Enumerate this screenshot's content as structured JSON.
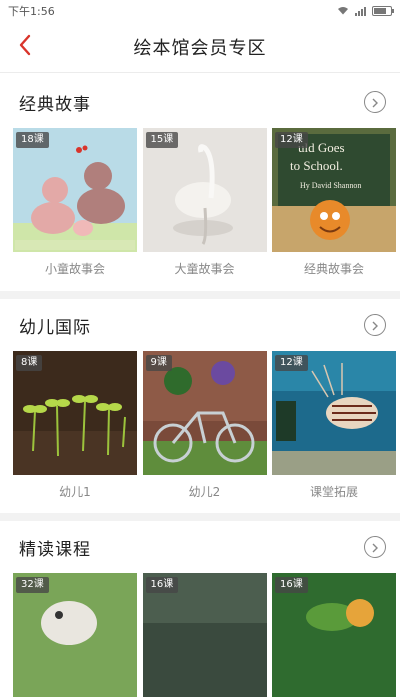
{
  "status": {
    "time": "下午1:56"
  },
  "header": {
    "title": "绘本馆会员专区"
  },
  "sections": [
    {
      "title": "经典故事",
      "items": [
        {
          "badge": "18课",
          "label": "小童故事会"
        },
        {
          "badge": "15课",
          "label": "大童故事会"
        },
        {
          "badge": "12课",
          "label": "经典故事会",
          "cover_text": [
            "uld Goes",
            "to School.",
            "Hy David Shannon"
          ]
        }
      ]
    },
    {
      "title": "幼儿国际",
      "items": [
        {
          "badge": "8课",
          "label": "幼儿1"
        },
        {
          "badge": "9课",
          "label": "幼儿2"
        },
        {
          "badge": "12课",
          "label": "课堂拓展"
        }
      ]
    },
    {
      "title": "精读课程",
      "items": [
        {
          "badge": "32课",
          "label": ""
        },
        {
          "badge": "16课",
          "label": ""
        },
        {
          "badge": "16课",
          "label": ""
        }
      ]
    }
  ],
  "colors": {
    "back_arrow": "#d9342b",
    "divider": "#f2f2f2"
  }
}
